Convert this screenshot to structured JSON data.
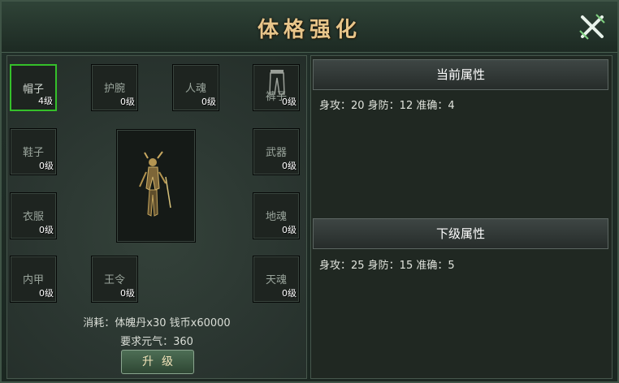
{
  "window": {
    "title": "体格强化"
  },
  "slots": [
    {
      "name": "帽子",
      "level": "4级"
    },
    {
      "name": "护腕",
      "level": "0级"
    },
    {
      "name": "人魂",
      "level": "0级"
    },
    {
      "name": "裤子",
      "level": "0级"
    },
    {
      "name": "鞋子",
      "level": "0级"
    },
    {
      "name": "武器",
      "level": "0级"
    },
    {
      "name": "衣服",
      "level": "0级"
    },
    {
      "name": "地魂",
      "level": "0级"
    },
    {
      "name": "内甲",
      "level": "0级"
    },
    {
      "name": "王令",
      "level": "0级"
    },
    {
      "name": "天魂",
      "level": "0级"
    }
  ],
  "upgrade": {
    "cost": "消耗：体魄丹x30 钱币x60000",
    "requirement": "要求元气：360",
    "button_label": "升级"
  },
  "current": {
    "header": "当前属性",
    "stats": "身攻：20 身防：12 准确：4"
  },
  "next": {
    "header": "下级属性",
    "stats": "身攻：25 身防：15 准确：5"
  },
  "colors": {
    "title": "#e8c58a",
    "selected_border": "#35c02a",
    "panel": "#202822"
  }
}
